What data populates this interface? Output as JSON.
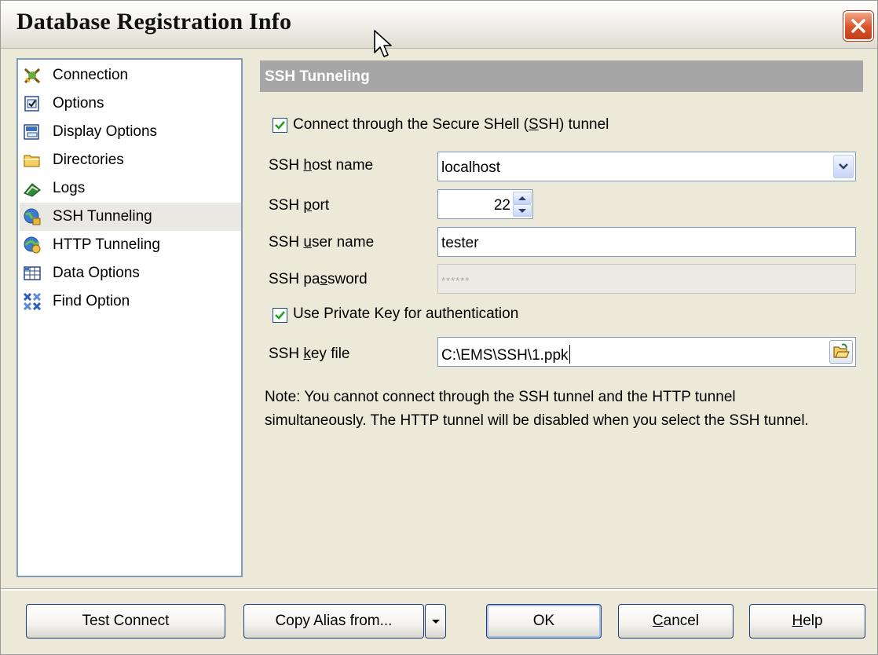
{
  "window": {
    "title": "Database Registration Info"
  },
  "nav": {
    "items": [
      {
        "label": "Connection",
        "icon": "connection-icon"
      },
      {
        "label": "Options",
        "icon": "options-icon"
      },
      {
        "label": "Display Options",
        "icon": "display-options-icon"
      },
      {
        "label": "Directories",
        "icon": "folder-icon"
      },
      {
        "label": "Logs",
        "icon": "logs-icon"
      },
      {
        "label": "SSH Tunneling",
        "icon": "ssh-tunneling-icon",
        "selected": true
      },
      {
        "label": "HTTP Tunneling",
        "icon": "http-tunneling-icon"
      },
      {
        "label": "Data Options",
        "icon": "data-options-icon"
      },
      {
        "label": "Find Option",
        "icon": "find-option-icon"
      }
    ]
  },
  "ssh": {
    "header": "SSH Tunneling",
    "connect": {
      "checked": true,
      "pre": "Connect through the Secure SHell (",
      "u": "S",
      "post": "SH) tunnel"
    },
    "host": {
      "pre": "SSH ",
      "u": "h",
      "post": "ost name",
      "value": "localhost"
    },
    "port": {
      "pre": "SSH ",
      "u": "p",
      "post": "ort",
      "value": "22"
    },
    "user": {
      "pre": "SSH ",
      "u": "u",
      "post": "ser name",
      "value": "tester"
    },
    "password": {
      "pre": "SSH pa",
      "u": "s",
      "post": "sword",
      "value": "******",
      "disabled": true
    },
    "private_key": {
      "checked": true,
      "label": "Use Private Key for authentication"
    },
    "key_file": {
      "pre": "SSH ",
      "u": "k",
      "post": "ey file",
      "value": "C:\\EMS\\SSH\\1.ppk"
    },
    "note": "Note: You cannot connect through the SSH tunnel and the HTTP tunnel simultaneously. The HTTP tunnel will be disabled  when you select the SSH tunnel."
  },
  "buttons": {
    "test_connect": "Test Connect",
    "copy_alias": "Copy Alias from...",
    "ok": "OK",
    "cancel": {
      "u": "C",
      "post": "ancel"
    },
    "help": {
      "u": "H",
      "post": "elp"
    }
  },
  "colors": {
    "selected_item": "#e9e8e2",
    "section_header": "#a6a6a6",
    "dialog_bg": "#ece9d8",
    "close_button": "#d9532a"
  }
}
